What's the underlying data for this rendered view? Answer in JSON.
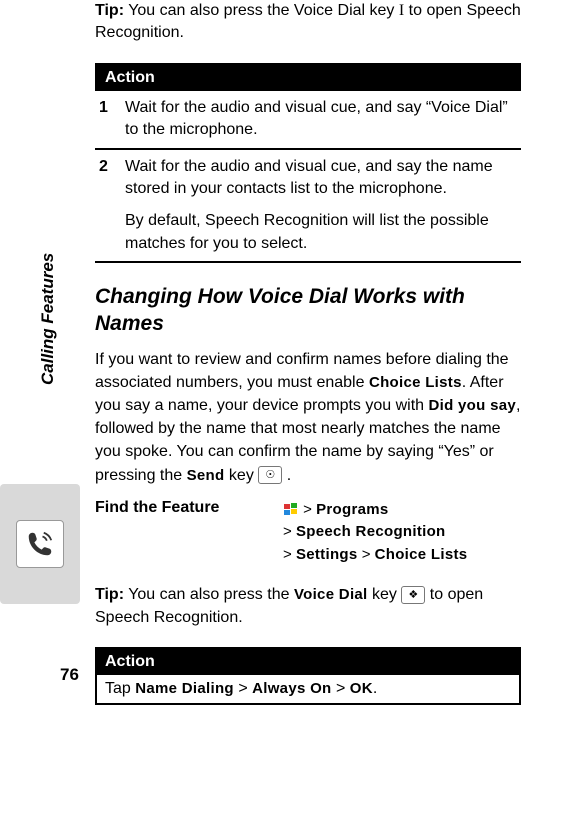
{
  "tip1": {
    "label": "Tip:",
    "text_a": "You can also press the Voice Dial key",
    "key_glyph": "I",
    "text_b": "to open Speech Recognition."
  },
  "table1": {
    "header": "Action",
    "rows": [
      {
        "num": "1",
        "text": "Wait for the audio and visual cue, and say “Voice Dial” to the microphone."
      },
      {
        "num": "2",
        "text": "Wait for the audio and visual cue, and say the name stored in your contacts list to the microphone.",
        "sub": "By default, Speech Recognition will list the possible matches for you to select."
      }
    ]
  },
  "sidebar": {
    "label": "Calling Features"
  },
  "section": {
    "heading": "Changing How Voice Dial Works with Names"
  },
  "para": {
    "p1a": "If you want to review and confirm names before dialing the associated numbers, you must enable ",
    "choice_lists": "Choice Lists",
    "p1b": ". After you say a name, your device prompts you with ",
    "did_you_say": "Did you say",
    "p1c": ", followed by the name that most nearly matches the name you spoke. You can confirm the name by saying “Yes” or pressing the ",
    "send": "Send",
    "p1d": " key ",
    "send_icon": "☉",
    "p1e": " ."
  },
  "find_feature": {
    "label": "Find the Feature",
    "path": [
      {
        "sep": ">",
        "term": "Programs"
      },
      {
        "sep": ">",
        "term": "Speech Recognition"
      },
      {
        "sep": ">",
        "term": "Settings"
      },
      {
        "sep": ">",
        "term": "Choice Lists"
      }
    ]
  },
  "tip2": {
    "label": "Tip:",
    "text_a": "You can also press the ",
    "voice_dial": "Voice Dial",
    "text_b": " key ",
    "icon": "❖",
    "text_c": " to open Speech Recognition."
  },
  "table2": {
    "header": "Action",
    "tap": "Tap ",
    "name_dialing": "Name Dialing",
    "sep1": " > ",
    "always_on": "Always On",
    "sep2": " > ",
    "ok": "OK",
    "period": "."
  },
  "page_number": "76"
}
